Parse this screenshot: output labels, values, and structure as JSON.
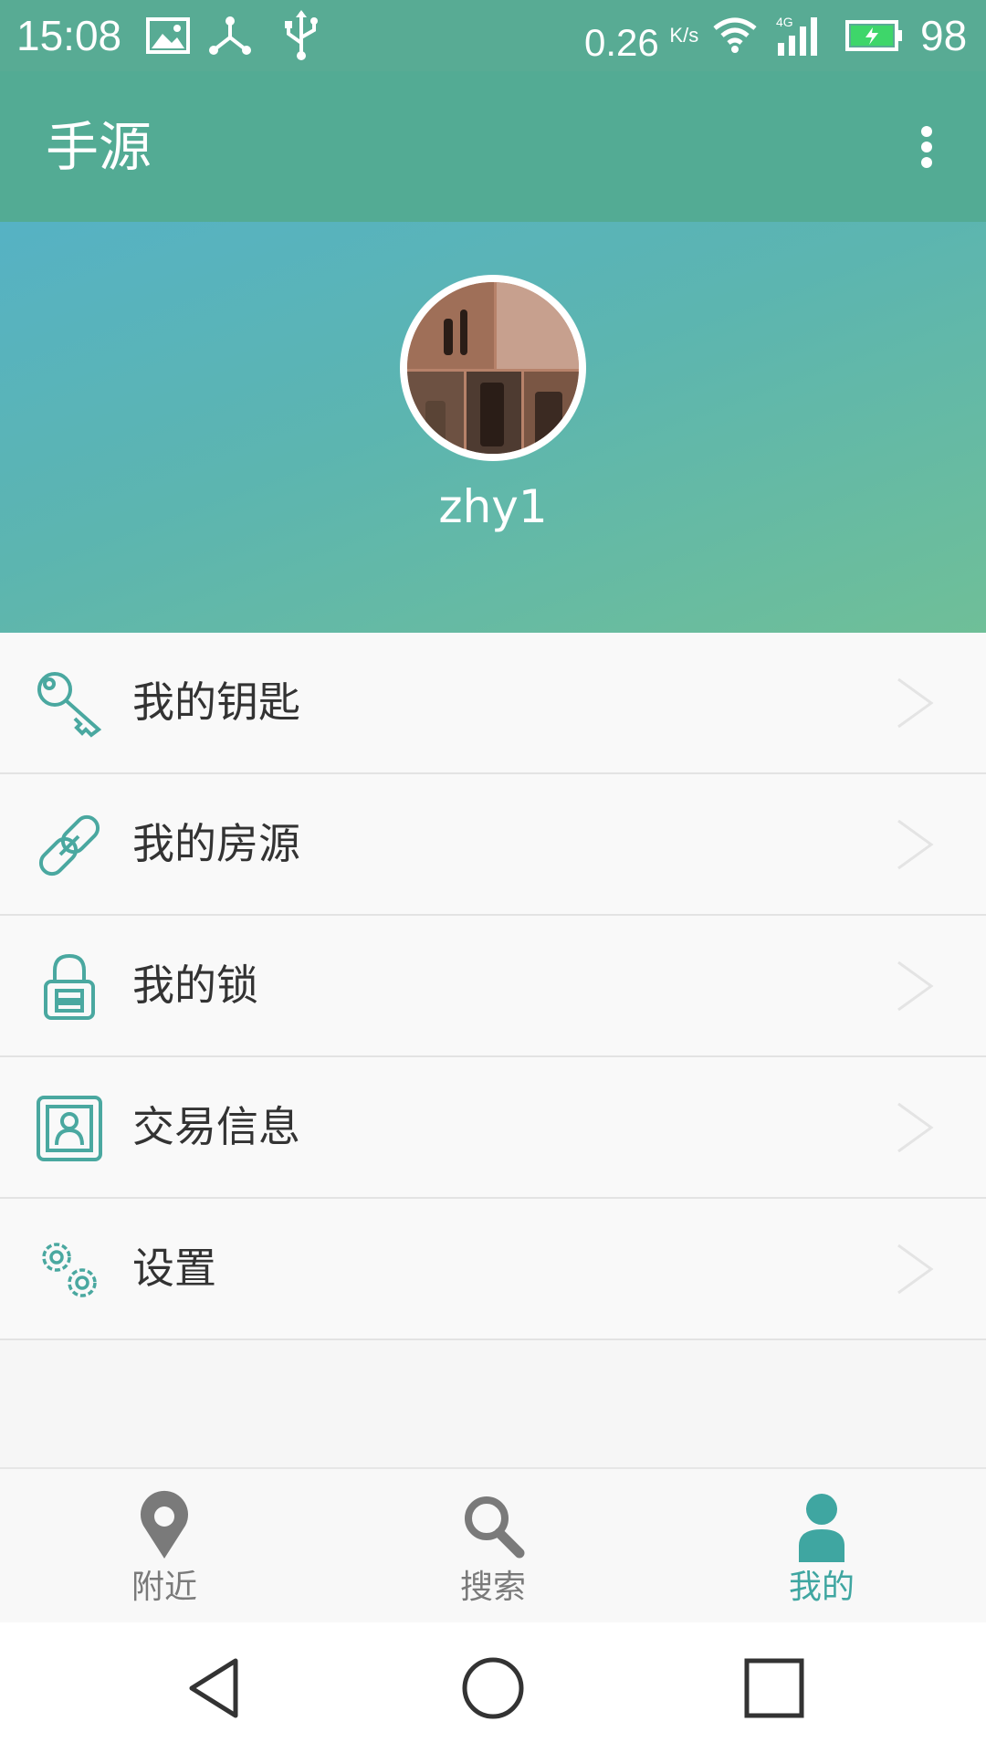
{
  "status_bar": {
    "time": "15:08",
    "net_speed": "0.26",
    "net_speed_unit": "K/s",
    "network": "4G",
    "battery": "98",
    "icons": [
      "image-icon",
      "share-icon",
      "usb-icon",
      "wifi-icon",
      "signal-icon",
      "battery-icon"
    ]
  },
  "app_bar": {
    "title": "手源"
  },
  "profile": {
    "username": "zhy1"
  },
  "menu": {
    "items": [
      {
        "label": "我的钥匙",
        "icon": "key-icon"
      },
      {
        "label": "我的房源",
        "icon": "link-icon"
      },
      {
        "label": "我的锁",
        "icon": "lock-icon"
      },
      {
        "label": "交易信息",
        "icon": "contact-card-icon"
      },
      {
        "label": "设置",
        "icon": "gears-icon"
      }
    ]
  },
  "tabs": {
    "items": [
      {
        "label": "附近",
        "icon": "location-pin-icon"
      },
      {
        "label": "搜索",
        "icon": "search-icon"
      },
      {
        "label": "我的",
        "icon": "person-icon",
        "active": true
      }
    ]
  },
  "colors": {
    "primary": "#53ab94",
    "accent": "#3fa6a1",
    "icon_teal": "#4aa8a0",
    "text": "#333333",
    "tab_inactive": "#7a7a7a"
  }
}
